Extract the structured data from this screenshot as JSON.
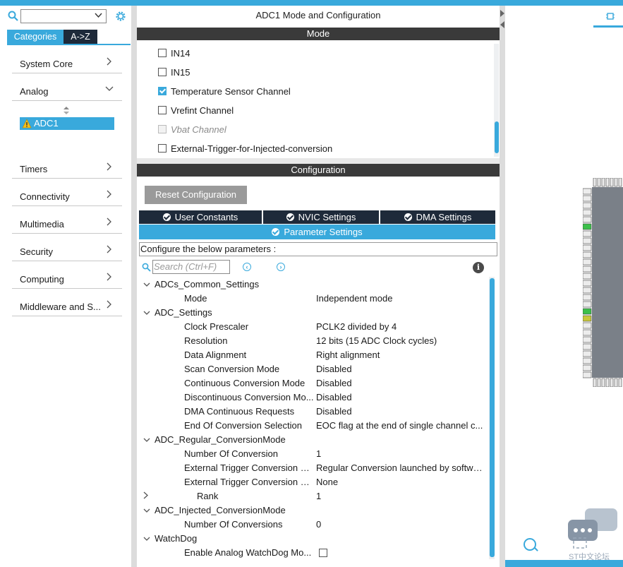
{
  "left": {
    "tabs": [
      "Categories",
      "A->Z"
    ],
    "categories": [
      {
        "label": "System Core",
        "chevron": ">"
      },
      {
        "label": "Analog",
        "chevron": "v"
      },
      {
        "label": "Timers",
        "chevron": ">"
      },
      {
        "label": "Connectivity",
        "chevron": ">"
      },
      {
        "label": "Multimedia",
        "chevron": ">"
      },
      {
        "label": "Security",
        "chevron": ">"
      },
      {
        "label": "Computing",
        "chevron": ">"
      },
      {
        "label": "Middleware and S...",
        "chevron": ">"
      }
    ],
    "selected_peripheral": "ADC1"
  },
  "middle": {
    "title": "ADC1 Mode and Configuration",
    "mode_header": "Mode",
    "mode_items": [
      {
        "label": "IN14",
        "checked": false,
        "disabled": false
      },
      {
        "label": "IN15",
        "checked": false,
        "disabled": false
      },
      {
        "label": "Temperature Sensor Channel",
        "checked": true,
        "disabled": false
      },
      {
        "label": "Vrefint Channel",
        "checked": false,
        "disabled": false
      },
      {
        "label": "Vbat Channel",
        "checked": false,
        "disabled": true
      },
      {
        "label": "External-Trigger-for-Injected-conversion",
        "checked": false,
        "disabled": false
      }
    ],
    "config_header": "Configuration",
    "reset_button": "Reset Configuration",
    "config_tabs": [
      "User Constants",
      "NVIC Settings",
      "DMA Settings"
    ],
    "active_tab": "Parameter Settings",
    "configure_text": "Configure the below parameters :",
    "search_placeholder": "Search (Ctrl+F)",
    "params": [
      {
        "kind": "group",
        "label": "ADCs_Common_Settings",
        "expanded": true
      },
      {
        "kind": "param",
        "name": "Mode",
        "value": "Independent mode"
      },
      {
        "kind": "group",
        "label": "ADC_Settings",
        "expanded": true
      },
      {
        "kind": "param",
        "name": "Clock Prescaler",
        "value": "PCLK2 divided by 4"
      },
      {
        "kind": "param",
        "name": "Resolution",
        "value": "12 bits (15 ADC Clock cycles)"
      },
      {
        "kind": "param",
        "name": "Data Alignment",
        "value": "Right alignment"
      },
      {
        "kind": "param",
        "name": "Scan Conversion Mode",
        "value": "Disabled"
      },
      {
        "kind": "param",
        "name": "Continuous Conversion Mode",
        "value": "Disabled"
      },
      {
        "kind": "param",
        "name": "Discontinuous Conversion Mo...",
        "value": "Disabled"
      },
      {
        "kind": "param",
        "name": "DMA Continuous Requests",
        "value": "Disabled"
      },
      {
        "kind": "param",
        "name": "End Of Conversion Selection",
        "value": "EOC flag at the end of single channel c..."
      },
      {
        "kind": "group",
        "label": "ADC_Regular_ConversionMode",
        "expanded": true
      },
      {
        "kind": "param",
        "name": "Number Of Conversion",
        "value": "1"
      },
      {
        "kind": "param",
        "name": "External Trigger Conversion S...",
        "value": "Regular Conversion launched by software"
      },
      {
        "kind": "param",
        "name": "External Trigger Conversion E...",
        "value": "None"
      },
      {
        "kind": "subgroup",
        "name": "Rank",
        "value": "1"
      },
      {
        "kind": "group",
        "label": "ADC_Injected_ConversionMode",
        "expanded": true
      },
      {
        "kind": "param",
        "name": "Number Of Conversions",
        "value": "0"
      },
      {
        "kind": "group",
        "label": "WatchDog",
        "expanded": true
      },
      {
        "kind": "param",
        "name": "Enable Analog WatchDog Mo...",
        "value": "",
        "checkbox": true
      }
    ]
  },
  "right": {
    "watermark": "ST中文论坛"
  },
  "colors": {
    "accent": "#39a9dc",
    "dark_tab": "#1e2a3a",
    "header": "#3a3a3a"
  }
}
